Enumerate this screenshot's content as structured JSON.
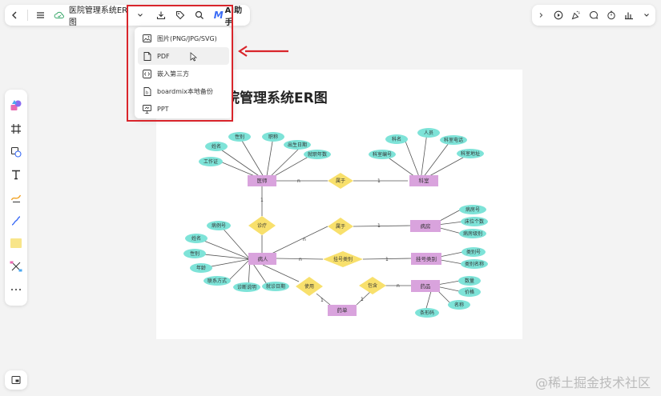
{
  "header": {
    "file_title": "医院管理系统ER图",
    "ai_label": "AI助手"
  },
  "export_menu": {
    "items": [
      {
        "label": "图片(PNG/JPG/SVG)",
        "icon": "image-icon"
      },
      {
        "label": "PDF",
        "icon": "pdf-file-icon"
      },
      {
        "label": "嵌入第三方",
        "icon": "embed-icon"
      },
      {
        "label": "boardmix本地备份",
        "icon": "backup-file-icon"
      },
      {
        "label": "PPT",
        "icon": "presentation-icon"
      }
    ]
  },
  "diagram": {
    "title": "院管理系统ER图",
    "entities": {
      "doctor": "医师",
      "department": "科室",
      "patient": "病人",
      "ward": "病房",
      "registration_type": "挂号类别",
      "medicine": "药品",
      "prescription": "药单"
    },
    "relations": {
      "belongs_dept": "属于",
      "treat": "诊疗",
      "belongs_ward": "属于",
      "register": "挂号类别",
      "use": "使用",
      "contain": "包含"
    },
    "attributes": {
      "doctor": [
        "工作证",
        "姓名",
        "性别",
        "职称",
        "出生日期",
        "就职年数"
      ],
      "department": [
        "科室编号",
        "科名",
        "人员",
        "科室电话",
        "科室地址"
      ],
      "patient": [
        "病例号",
        "姓名",
        "性别",
        "年龄",
        "联系方式",
        "诊断说明",
        "就诊日期"
      ],
      "ward": [
        "病房号",
        "床位个数",
        "病房级别"
      ],
      "registration_type": [
        "类别号",
        "类别名称"
      ],
      "medicine": [
        "数量",
        "价格",
        "名称",
        "条形码"
      ]
    },
    "cardinality": {
      "n": "n",
      "one": "1"
    }
  },
  "watermark": "@稀土掘金技术社区",
  "colors": {
    "entity": "#d9a3dd",
    "relation": "#f8e06c",
    "attribute": "#7ee3d8",
    "highlight": "#d9252b",
    "ai_accent": "#3b6cf6"
  }
}
